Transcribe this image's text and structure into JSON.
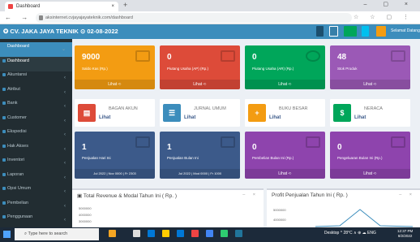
{
  "browser": {
    "tab_title": "Dashboard",
    "tab_close": "×",
    "new_tab": "+",
    "window_controls": "– ▢ ×",
    "nav": "← → C",
    "url": "aksinternet.cvjayajayateknik.com/dashboard",
    "icons": "☆ ☆ ▢ ⋮"
  },
  "header": {
    "brand": "CV. JAKA JAYA TEKNIK",
    "date": "02-08-2022",
    "username": "Selamat Datang",
    "accent": "#3c8dbc"
  },
  "sidebar": {
    "items": [
      {
        "label": "Dashboard",
        "chevron": "⌄",
        "state": "active"
      },
      {
        "label": "Dashboard",
        "chevron": "",
        "state": "sub"
      },
      {
        "label": "Akuntansi",
        "chevron": "‹",
        "state": ""
      },
      {
        "label": "Atribut",
        "chevron": "‹",
        "state": ""
      },
      {
        "label": "Bank",
        "chevron": "‹",
        "state": ""
      },
      {
        "label": "Customer",
        "chevron": "‹",
        "state": ""
      },
      {
        "label": "Ekspedisi",
        "chevron": "‹",
        "state": ""
      },
      {
        "label": "Hak Akses",
        "chevron": "‹",
        "state": ""
      },
      {
        "label": "Inventori",
        "chevron": "‹",
        "state": ""
      },
      {
        "label": "Laporan",
        "chevron": "‹",
        "state": ""
      },
      {
        "label": "Opsi Umum",
        "chevron": "‹",
        "state": ""
      },
      {
        "label": "Pembelian",
        "chevron": "‹",
        "state": ""
      },
      {
        "label": "Penggunaan",
        "chevron": "‹",
        "state": ""
      }
    ]
  },
  "stat_cards": [
    {
      "value": "9000",
      "label": "Saldo Kas (Rp.)",
      "link": "Lihat",
      "color": "#f39c12"
    },
    {
      "value": "0",
      "label": "Piutang Usaha (AP) (Rp.)",
      "link": "Lihat",
      "color": "#dd4b39"
    },
    {
      "value": "0",
      "label": "Piutang Usaha (AR) (Rp.)",
      "link": "Lihat",
      "color": "#00a65a"
    },
    {
      "value": "48",
      "label": "Stok Produk",
      "link": "Lihat",
      "color": "#9b59b6"
    }
  ],
  "link_cards": [
    {
      "title": "BAGAN AKUN",
      "link": "Lihat",
      "color": "#dd4b39"
    },
    {
      "title": "JURNAL UMUM",
      "link": "Lihat",
      "color": "#3c8dbc"
    },
    {
      "title": "BUKU BESAR",
      "link": "Lihat",
      "color": "#f39c12"
    },
    {
      "title": "NERACA",
      "link": "Lihat",
      "color": "#00a65a"
    }
  ],
  "sales_cards": [
    {
      "value": "1",
      "label": "Penjualan Hari Ini",
      "foot": "Jul 2022 | Nov 0000 | Fr 2303",
      "color": "#3c5a8a"
    },
    {
      "value": "1",
      "label": "Penjualan Bulan Ini",
      "foot": "Jul 2022 | Mod 0000 | Fr 1000",
      "color": "#3c5a8a"
    },
    {
      "value": "0",
      "label": "Pembelian Bulan Ini (Rp.)",
      "foot": "Lihat",
      "color": "#8e44ad"
    },
    {
      "value": "0",
      "label": "Pengeluaran Bulan Ini (Rp.)",
      "foot": "Lihat",
      "color": "#8e44ad"
    }
  ],
  "panels": {
    "left_title": "Total Revenue & Modal Tahun Ini ( Rp. )",
    "left_ticks": [
      "5000000",
      "4000000",
      "3000000"
    ],
    "right_title": "Profit Penjualan Tahun Ini ( Rp. )",
    "right_ticks": [
      "5000000",
      "4000000"
    ],
    "tools": "– ×"
  },
  "taskbar": {
    "search": "Type here to search",
    "tray": "Desktop  ^  28°C  ∧  ⊕  ☁  ENG",
    "time": "12:37 PM",
    "date": "8/2/2022"
  }
}
